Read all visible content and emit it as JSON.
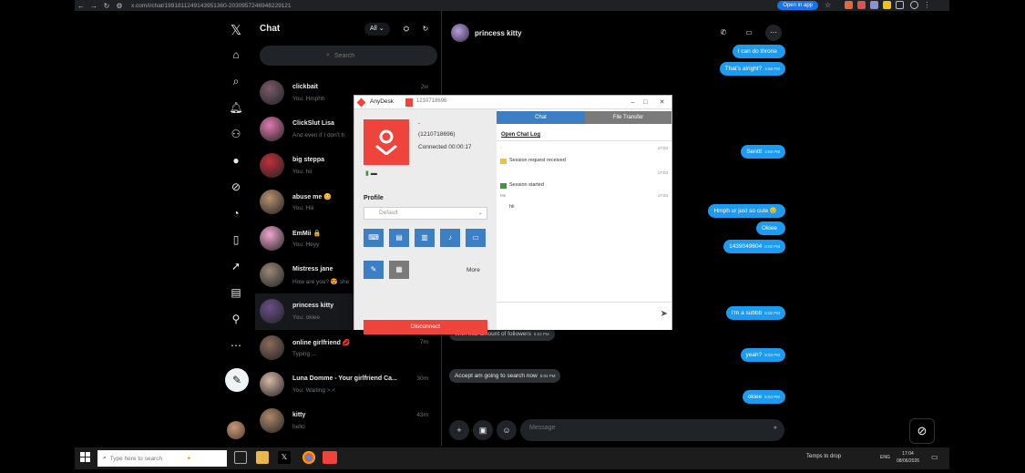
{
  "browser": {
    "url": "x.com/i/chat/1991811249143951360-2030957246948229121",
    "open_in_app": "Open in app"
  },
  "x_nav": {
    "logo": "𝕏",
    "icons": [
      "home-icon",
      "explore-icon",
      "notifications-icon",
      "follow-icon",
      "chat-icon",
      "grok-icon",
      "communities-icon",
      "bookmarks-icon",
      "premium-icon",
      "lists-icon",
      "profile-icon",
      "more-icon"
    ]
  },
  "chat_list": {
    "title": "Chat",
    "filter": "All",
    "search_placeholder": "Search",
    "conversations": [
      {
        "name": "clickbait",
        "preview": "You: Hmphh",
        "time": "2w",
        "color": "#7a5a6a"
      },
      {
        "name": "ClickSlut Lisa",
        "preview": "And even if I don't h",
        "time": "",
        "color": "#e07ab0"
      },
      {
        "name": "big steppa",
        "preview": "You: hii",
        "time": "",
        "color": "#c0303a"
      },
      {
        "name": "abuse me 😊",
        "preview": "You: Hiii",
        "time": "",
        "color": "#b89070"
      },
      {
        "name": "EmMii 🔒",
        "preview": "You: Heyy",
        "time": "",
        "color": "#f0a8d0"
      },
      {
        "name": "Mistress jane",
        "preview": "How are you? 😍 she",
        "time": "",
        "color": "#9a8878"
      },
      {
        "name": "princess kitty",
        "preview": "You: okiee",
        "time": "",
        "color": "#6a5088"
      },
      {
        "name": "online girlfriend 💋",
        "preview": "Typing ...",
        "time": "7m",
        "color": "#8a6a5a"
      },
      {
        "name": "Luna Domme - Your girlfriend Ca...",
        "preview": "You: Waiting >.<",
        "time": "30m",
        "color": "#d8b8a8"
      },
      {
        "name": "kitty",
        "preview": "hello",
        "time": "43m",
        "color": "#b08868"
      }
    ]
  },
  "thread": {
    "name": "princess kitty",
    "messages": [
      {
        "text": "I can do throne",
        "time": "",
        "side": "me"
      },
      {
        "text": "That's alright?",
        "time": "4:58 PM",
        "side": "me"
      },
      {
        "text": "Senttt",
        "time": "4:59 PM",
        "side": "me"
      },
      {
        "text": "Hmph ur just so cute 😊",
        "time": "",
        "side": "me"
      },
      {
        "text": "Okiee",
        "time": "",
        "side": "me"
      },
      {
        "text": "1439049604",
        "time": "5:00 PM",
        "side": "me"
      },
      {
        "text": "I'm a subbb",
        "time": "5:02 PM",
        "side": "me"
      },
      {
        "text": "With that amount of followers",
        "time": "5:03 PM",
        "side": "them"
      },
      {
        "text": "yeah?",
        "time": "5:03 PM",
        "side": "me"
      },
      {
        "text": "Accept am going to search now",
        "time": "5:04 PM",
        "side": "them"
      },
      {
        "text": "okiee",
        "time": "5:04 PM",
        "side": "me"
      }
    ],
    "composer_placeholder": "Message"
  },
  "anydesk": {
    "title": "AnyDesk",
    "session_id": "1210718696",
    "user": "-",
    "id_display": "(1210718696)",
    "status": "Connected 00:00:17",
    "profile_label": "Profile",
    "profile_value": "Default",
    "more": "More",
    "disconnect": "Disconnect",
    "tabs": {
      "chat": "Chat",
      "file_transfer": "File Transfer"
    },
    "open_chat_log": "Open Chat Log",
    "log": [
      {
        "time": "17:04",
        "text": "-"
      },
      {
        "time": "",
        "text": "Session request received"
      },
      {
        "time": "17:04",
        "text": ""
      },
      {
        "time": "",
        "text": "Session started"
      },
      {
        "time": "17:04",
        "text": "Me"
      },
      {
        "time": "",
        "text": "hii"
      }
    ]
  },
  "taskbar": {
    "search_placeholder": "Type here to search",
    "tray_text": "Temps to drop",
    "lang": "ENG",
    "time": "17:04",
    "date": "08/06/2026"
  },
  "colors": {
    "x_blue": "#1d9bf0",
    "anydesk_red": "#ef443b",
    "anydesk_blue": "#3d7fc4"
  }
}
